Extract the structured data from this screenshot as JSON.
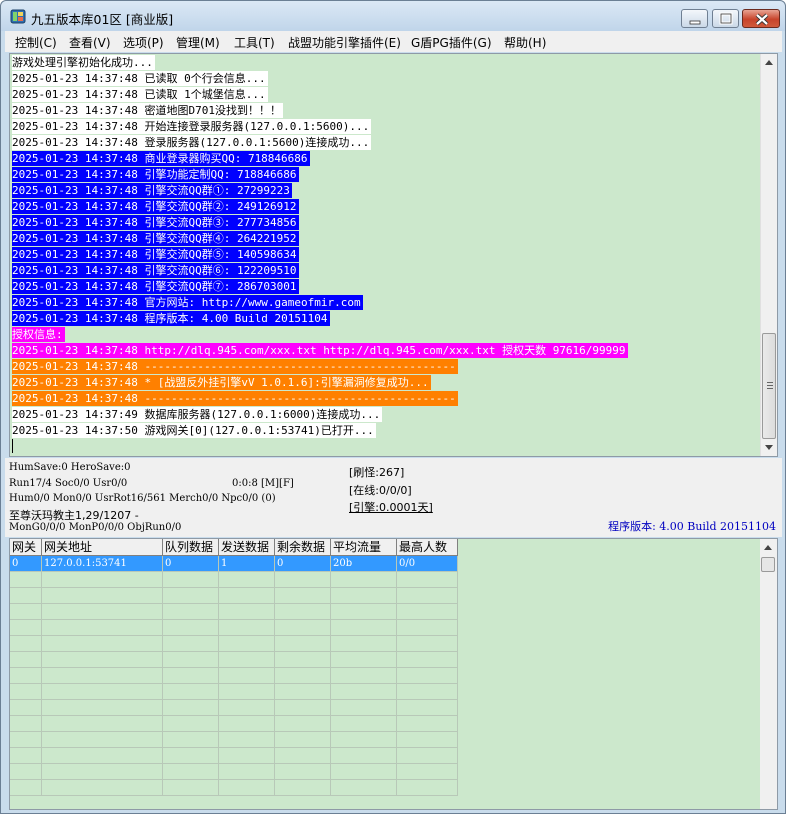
{
  "window": {
    "title": "九五版本库01区 [商业版]"
  },
  "menu": [
    {
      "label": "控制(C)"
    },
    {
      "label": "查看(V)"
    },
    {
      "label": "选项(P)"
    },
    {
      "label": "管理(M)"
    },
    {
      "label": "工具(T)"
    },
    {
      "label": "战盟功能引擎插件(E)"
    },
    {
      "label": "G盾PG插件(G)"
    },
    {
      "label": "帮助(H)"
    }
  ],
  "log": [
    {
      "text": "游戏处理引擎初始化成功...",
      "style": "white"
    },
    {
      "text": "2025-01-23 14:37:48 已读取 0个行会信息...",
      "style": "white"
    },
    {
      "text": "2025-01-23 14:37:48 已读取 1个城堡信息...",
      "style": "white"
    },
    {
      "text": "2025-01-23 14:37:48 密道地图D701没找到！！！",
      "style": "white"
    },
    {
      "text": "2025-01-23 14:37:48 开始连接登录服务器(127.0.0.1:5600)...",
      "style": "white"
    },
    {
      "text": "2025-01-23 14:37:48 登录服务器(127.0.0.1:5600)连接成功...",
      "style": "white"
    },
    {
      "text": "2025-01-23 14:37:48 商业登录器购买QQ: 718846686",
      "style": "blue"
    },
    {
      "text": "2025-01-23 14:37:48 引擎功能定制QQ: 718846686",
      "style": "blue"
    },
    {
      "text": "2025-01-23 14:37:48 引擎交流QQ群①: 27299223",
      "style": "blue"
    },
    {
      "text": "2025-01-23 14:37:48 引擎交流QQ群②: 249126912",
      "style": "blue"
    },
    {
      "text": "2025-01-23 14:37:48 引擎交流QQ群③: 277734856",
      "style": "blue"
    },
    {
      "text": "2025-01-23 14:37:48 引擎交流QQ群④: 264221952",
      "style": "blue"
    },
    {
      "text": "2025-01-23 14:37:48 引擎交流QQ群⑤: 140598634",
      "style": "blue"
    },
    {
      "text": "2025-01-23 14:37:48 引擎交流QQ群⑥: 122209510",
      "style": "blue"
    },
    {
      "text": "2025-01-23 14:37:48 引擎交流QQ群⑦: 286703001",
      "style": "blue"
    },
    {
      "text": "2025-01-23 14:37:48 官方网站: http://www.gameofmir.com",
      "style": "blue"
    },
    {
      "text": "2025-01-23 14:37:48 程序版本: 4.00 Build 20151104",
      "style": "blue"
    },
    {
      "text": "授权信息:",
      "style": "magenta"
    },
    {
      "text": "2025-01-23 14:37:48 http://dlq.945.com/xxx.txt http://dlq.945.com/xxx.txt 授权天数 97616/99999",
      "style": "magenta"
    },
    {
      "text": "2025-01-23 14:37:48 -----------------------------------------------",
      "style": "orange"
    },
    {
      "text": "2025-01-23 14:37:48 * [战盟反外挂引擎vV 1.0.1.6]:引擎漏洞修复成功...",
      "style": "orange"
    },
    {
      "text": "2025-01-23 14:37:48 -----------------------------------------------",
      "style": "orange"
    },
    {
      "text": "2025-01-23 14:37:49 数据库服务器(127.0.0.1:6000)连接成功...",
      "style": "white"
    },
    {
      "text": "2025-01-23 14:37:50 游戏网关[0](127.0.0.1:53741)已打开...",
      "style": "white"
    }
  ],
  "status": {
    "line1": "HumSave:0 HeroSave:0",
    "line2a": "Run17/4 Soc0/0 Usr0/0",
    "line2b": "0:0:8 [M][F]",
    "line3": "Hum0/0 Mon0/0 UsrRot16/561 Merch0/0 Npc0/0 (0)",
    "line4": "至尊沃玛教主1,29/1207 -",
    "line5": "MonG0/0/0 MonP0/0/0 ObjRun0/0",
    "refresh": "[刷怪:267]",
    "online": "[在线:0/0/0]",
    "engine": "[引擎:0.0001天]",
    "version": "程序版本: 4.00 Build 20151104"
  },
  "grid": {
    "columns": [
      "网关",
      "网关地址",
      "队列数据",
      "发送数据",
      "剩余数据",
      "平均流量",
      "最高人数"
    ],
    "rows": [
      [
        "0",
        "127.0.0.1:53741",
        "0",
        "1",
        "0",
        "20b",
        "0/0"
      ]
    ]
  }
}
